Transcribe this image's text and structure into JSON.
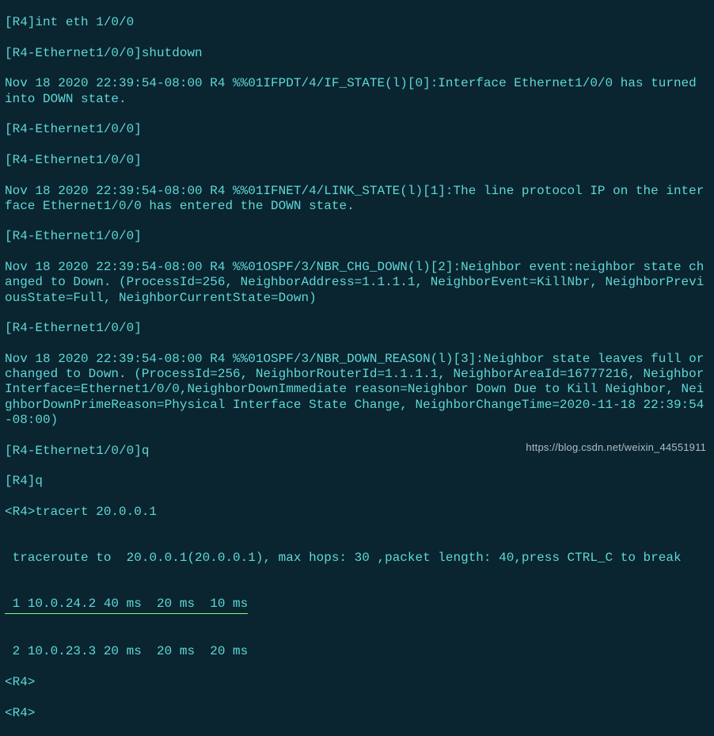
{
  "lines": {
    "l1": "[R4]int eth 1/0/0",
    "l2": "[R4-Ethernet1/0/0]shutdown",
    "l3": "Nov 18 2020 22:39:54-08:00 R4 %%01IFPDT/4/IF_STATE(l)[0]:Interface Ethernet1/0/0 has turned into DOWN state.",
    "l4": "[R4-Ethernet1/0/0]",
    "l5": "[R4-Ethernet1/0/0]",
    "l6": "Nov 18 2020 22:39:54-08:00 R4 %%01IFNET/4/LINK_STATE(l)[1]:The line protocol IP on the interface Ethernet1/0/0 has entered the DOWN state.",
    "l7": "[R4-Ethernet1/0/0]",
    "l8": "Nov 18 2020 22:39:54-08:00 R4 %%01OSPF/3/NBR_CHG_DOWN(l)[2]:Neighbor event:neighbor state changed to Down. (ProcessId=256, NeighborAddress=1.1.1.1, NeighborEvent=KillNbr, NeighborPreviousState=Full, NeighborCurrentState=Down)",
    "l9": "[R4-Ethernet1/0/0]",
    "l10": "Nov 18 2020 22:39:54-08:00 R4 %%01OSPF/3/NBR_DOWN_REASON(l)[3]:Neighbor state leaves full or changed to Down. (ProcessId=256, NeighborRouterId=1.1.1.1, NeighborAreaId=16777216, NeighborInterface=Ethernet1/0/0,NeighborDownImmediate reason=Neighbor Down Due to Kill Neighbor, NeighborDownPrimeReason=Physical Interface State Change, NeighborChangeTime=2020-11-18 22:39:54-08:00)",
    "l11": "[R4-Ethernet1/0/0]q",
    "l12": "[R4]q",
    "l13": "<R4>tracert 20.0.0.1",
    "l14": "",
    "l15": " traceroute to  20.0.0.1(20.0.0.1), max hops: 30 ,packet length: 40,press CTRL_C to break",
    "l16": "",
    "hop1": " 1 10.0.24.2 40 ms  20 ms  10 ms",
    "l18": "",
    "l19": " 2 10.0.23.3 20 ms  20 ms  20 ms",
    "l20": "<R4>",
    "l21": "<R4>"
  },
  "watermark": {
    "text": "https://blog.csdn.net/weixin_44551911"
  }
}
